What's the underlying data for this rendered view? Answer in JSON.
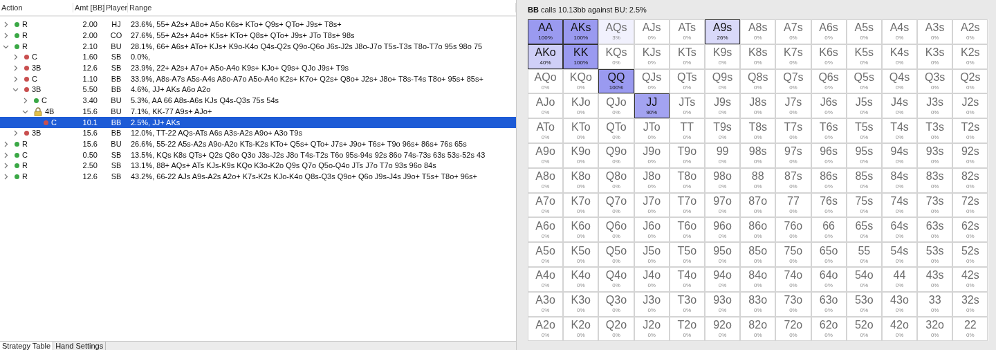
{
  "strategy_table": {
    "columns": [
      "Action",
      "Amt [BB]",
      "Player",
      "Range"
    ],
    "rows": [
      {
        "action": "R",
        "amount": "2.00",
        "player": "HJ",
        "range": "23.6%, 55+ A2s+ A8o+ A5o K6s+ KTo+ Q9s+ QTo+ J9s+ T8s+",
        "kind": "dot",
        "color": "#3aa845",
        "expanded": false,
        "selected": false
      },
      {
        "action": "R",
        "amount": "2.00",
        "player": "CO",
        "range": "27.6%, 55+ A2s+ A4o+ K5s+ KTo+ Q8s+ QTo+ J9s+ JTo T8s+ 98s",
        "kind": "dot",
        "color": "#3aa845",
        "expanded": false,
        "selected": false
      },
      {
        "action": "R",
        "amount": "2.10",
        "player": "BU",
        "range": "28.1%, 66+ A6s+ ATo+ KJs+ K9o-K4o Q4s-Q2s Q9o-Q6o J6s-J2s J8o-J7o T5s-T3s T8o-T7o 95s 98o 75",
        "kind": "dot",
        "color": "#3aa845",
        "expanded": true,
        "selected": false,
        "children": [
          {
            "action": "C",
            "amount": "1.60",
            "player": "SB",
            "range": "0.0%,",
            "kind": "dot",
            "color": "#c94f4f",
            "expanded": false,
            "selected": false
          },
          {
            "action": "3B",
            "amount": "12.6",
            "player": "SB",
            "range": "23.9%, 22+ A2s+ A7o+ A5o-A4o K9s+ KJo+ Q9s+ QJo J9s+ T9s",
            "kind": "dot",
            "color": "#c94f4f",
            "expanded": false,
            "selected": false
          },
          {
            "action": "C",
            "amount": "1.10",
            "player": "BB",
            "range": "33.9%, A8s-A7s A5s-A4s A8o-A7o A5o-A4o K2s+ K7o+ Q2s+ Q8o+ J2s+ J8o+ T8s-T4s T8o+ 95s+ 85s+",
            "kind": "dot",
            "color": "#c94f4f",
            "expanded": false,
            "selected": false
          },
          {
            "action": "3B",
            "amount": "5.50",
            "player": "BB",
            "range": "4.6%, JJ+ AKs A6o A2o",
            "kind": "dot",
            "color": "#c94f4f",
            "expanded": true,
            "selected": false,
            "children": [
              {
                "action": "C",
                "amount": "3.40",
                "player": "BU",
                "range": "5.3%, AA 66 A8s-A6s KJs Q4s-Q3s 75s 54s",
                "kind": "dot",
                "color": "#3aa845",
                "expanded": false,
                "selected": false
              },
              {
                "action": "4B",
                "amount": "15.6",
                "player": "BU",
                "range": "7.1%, KK-77 A9s+ AJo+",
                "kind": "lock",
                "expanded": true,
                "selected": false,
                "children": [
                  {
                    "action": "C",
                    "amount": "10.1",
                    "player": "BB",
                    "range": "2.5%, JJ+ AKs",
                    "kind": "dot",
                    "color": "#c94f4f",
                    "selected": true
                  }
                ]
              }
            ]
          },
          {
            "action": "3B",
            "amount": "15.6",
            "player": "BB",
            "range": "12.0%, TT-22 AQs-ATs A6s A3s-A2s A9o+ A3o T9s",
            "kind": "dot",
            "color": "#c94f4f",
            "expanded": false,
            "selected": false
          }
        ]
      },
      {
        "action": "R",
        "amount": "15.6",
        "player": "BU",
        "range": "26.6%, 55-22 A5s-A2s A9o-A2o KTs-K2s KTo+ Q5s+ QTo+ J7s+ J9o+ T6s+ T9o 96s+ 86s+ 76s 65s",
        "kind": "dot",
        "color": "#3aa845",
        "expanded": false,
        "selected": false
      },
      {
        "action": "C",
        "amount": "0.50",
        "player": "SB",
        "range": "13.5%, KQs K8s QTs+ Q2s Q8o Q3o J3s-J2s J8o T4s-T2s T6o 95s-94s 92s 86o 74s-73s 63s 53s-52s 43",
        "kind": "dot",
        "color": "#3aa845",
        "expanded": false,
        "selected": false
      },
      {
        "action": "R",
        "amount": "2.50",
        "player": "SB",
        "range": "13.1%, 88+ AQs+ ATs KJs-K9s KQo K3o-K2o Q9s Q7o Q5o-Q4o JTs J7o T7o 93s 96o 84s",
        "kind": "dot",
        "color": "#3aa845",
        "expanded": false,
        "selected": false
      },
      {
        "action": "R",
        "amount": "12.6",
        "player": "SB",
        "range": "43.2%, 66-22 AJs A9s-A2s A2o+ K7s-K2s KJo-K4o Q8s-Q3s Q9o+ Q6o J9s-J4s J9o+ T5s+ T8o+ 96s+",
        "kind": "dot",
        "color": "#3aa845",
        "expanded": false,
        "selected": false
      }
    ]
  },
  "tabs": [
    {
      "label": "Strategy Table",
      "selected": true
    },
    {
      "label": "Hand Settings",
      "selected": false
    }
  ],
  "range_panel": {
    "title": "**BB** calls 10.13bb against BU: 2.5%",
    "grid": {
      "rows": [
        {
          "cells": [
            {
              "hand": "AA",
              "pct": "100%",
              "color": "#9a9af0",
              "outlined": true
            },
            {
              "hand": "AKs",
              "pct": "100%",
              "color": "#9a9af0",
              "outlined": true
            },
            {
              "hand": "AQs",
              "pct": "3%",
              "color": "#f1f1fd",
              "outlined": false
            },
            {
              "hand": "AJs",
              "pct": "0%",
              "color": "#ffffff",
              "outlined": false
            },
            {
              "hand": "ATs",
              "pct": "0%",
              "color": "#ffffff",
              "outlined": false
            },
            {
              "hand": "A9s",
              "pct": "26%",
              "color": "#d9d9f9",
              "outlined": true
            },
            {
              "hand": "A8s",
              "pct": "0%",
              "color": "#ffffff",
              "outlined": false
            },
            {
              "hand": "A7s",
              "pct": "0%",
              "color": "#ffffff",
              "outlined": false
            },
            {
              "hand": "A6s",
              "pct": "0%",
              "color": "#ffffff",
              "outlined": false
            },
            {
              "hand": "A5s",
              "pct": "0%",
              "color": "#ffffff",
              "outlined": false
            },
            {
              "hand": "A4s",
              "pct": "0%",
              "color": "#ffffff",
              "outlined": false
            },
            {
              "hand": "A3s",
              "pct": "0%",
              "color": "#ffffff",
              "outlined": false
            },
            {
              "hand": "A2s",
              "pct": "0%",
              "color": "#ffffff",
              "outlined": false
            }
          ]
        },
        {
          "cells": [
            {
              "hand": "AKo",
              "pct": "40%",
              "color": "#cfcff7",
              "outlined": true
            },
            {
              "hand": "KK",
              "pct": "100%",
              "color": "#9a9af0",
              "outlined": true
            },
            {
              "hand": "KQs",
              "pct": "0%",
              "color": "#ffffff",
              "outlined": false
            },
            {
              "hand": "KJs",
              "pct": "0%",
              "color": "#ffffff",
              "outlined": false
            },
            {
              "hand": "KTs",
              "pct": "0%",
              "color": "#ffffff",
              "outlined": false
            },
            {
              "hand": "K9s",
              "pct": "0%",
              "color": "#ffffff",
              "outlined": false
            },
            {
              "hand": "K8s",
              "pct": "0%",
              "color": "#ffffff",
              "outlined": false
            },
            {
              "hand": "K7s",
              "pct": "0%",
              "color": "#ffffff",
              "outlined": false
            },
            {
              "hand": "K6s",
              "pct": "0%",
              "color": "#ffffff",
              "outlined": false
            },
            {
              "hand": "K5s",
              "pct": "0%",
              "color": "#ffffff",
              "outlined": false
            },
            {
              "hand": "K4s",
              "pct": "0%",
              "color": "#ffffff",
              "outlined": false
            },
            {
              "hand": "K3s",
              "pct": "0%",
              "color": "#ffffff",
              "outlined": false
            },
            {
              "hand": "K2s",
              "pct": "0%",
              "color": "#ffffff",
              "outlined": false
            }
          ]
        },
        {
          "cells": [
            {
              "hand": "AQo",
              "pct": "0%",
              "color": "#ffffff",
              "outlined": false
            },
            {
              "hand": "KQo",
              "pct": "0%",
              "color": "#ffffff",
              "outlined": false
            },
            {
              "hand": "QQ",
              "pct": "100%",
              "color": "#9a9af0",
              "outlined": true
            },
            {
              "hand": "QJs",
              "pct": "0%",
              "color": "#ffffff",
              "outlined": false
            },
            {
              "hand": "QTs",
              "pct": "0%",
              "color": "#ffffff",
              "outlined": false
            },
            {
              "hand": "Q9s",
              "pct": "0%",
              "color": "#ffffff",
              "outlined": false
            },
            {
              "hand": "Q8s",
              "pct": "0%",
              "color": "#ffffff",
              "outlined": false
            },
            {
              "hand": "Q7s",
              "pct": "0%",
              "color": "#ffffff",
              "outlined": false
            },
            {
              "hand": "Q6s",
              "pct": "0%",
              "color": "#ffffff",
              "outlined": false
            },
            {
              "hand": "Q5s",
              "pct": "0%",
              "color": "#ffffff",
              "outlined": false
            },
            {
              "hand": "Q4s",
              "pct": "0%",
              "color": "#ffffff",
              "outlined": false
            },
            {
              "hand": "Q3s",
              "pct": "0%",
              "color": "#ffffff",
              "outlined": false
            },
            {
              "hand": "Q2s",
              "pct": "0%",
              "color": "#ffffff",
              "outlined": false
            }
          ]
        },
        {
          "cells": [
            {
              "hand": "AJo",
              "pct": "0%",
              "color": "#ffffff",
              "outlined": false
            },
            {
              "hand": "KJo",
              "pct": "0%",
              "color": "#ffffff",
              "outlined": false
            },
            {
              "hand": "QJo",
              "pct": "0%",
              "color": "#ffffff",
              "outlined": false
            },
            {
              "hand": "JJ",
              "pct": "90%",
              "color": "#a3a3f1",
              "outlined": true
            },
            {
              "hand": "JTs",
              "pct": "0%",
              "color": "#ffffff",
              "outlined": false
            },
            {
              "hand": "J9s",
              "pct": "0%",
              "color": "#ffffff",
              "outlined": false
            },
            {
              "hand": "J8s",
              "pct": "0%",
              "color": "#ffffff",
              "outlined": false
            },
            {
              "hand": "J7s",
              "pct": "0%",
              "color": "#ffffff",
              "outlined": false
            },
            {
              "hand": "J6s",
              "pct": "0%",
              "color": "#ffffff",
              "outlined": false
            },
            {
              "hand": "J5s",
              "pct": "0%",
              "color": "#ffffff",
              "outlined": false
            },
            {
              "hand": "J4s",
              "pct": "0%",
              "color": "#ffffff",
              "outlined": false
            },
            {
              "hand": "J3s",
              "pct": "0%",
              "color": "#ffffff",
              "outlined": false
            },
            {
              "hand": "J2s",
              "pct": "0%",
              "color": "#ffffff",
              "outlined": false
            }
          ]
        },
        {
          "cells": [
            {
              "hand": "ATo",
              "pct": "0%",
              "color": "#ffffff",
              "outlined": false
            },
            {
              "hand": "KTo",
              "pct": "0%",
              "color": "#ffffff",
              "outlined": false
            },
            {
              "hand": "QTo",
              "pct": "0%",
              "color": "#ffffff",
              "outlined": false
            },
            {
              "hand": "JTo",
              "pct": "0%",
              "color": "#ffffff",
              "outlined": false
            },
            {
              "hand": "TT",
              "pct": "0%",
              "color": "#ffffff",
              "outlined": false
            },
            {
              "hand": "T9s",
              "pct": "0%",
              "color": "#ffffff",
              "outlined": false
            },
            {
              "hand": "T8s",
              "pct": "0%",
              "color": "#ffffff",
              "outlined": false
            },
            {
              "hand": "T7s",
              "pct": "0%",
              "color": "#ffffff",
              "outlined": false
            },
            {
              "hand": "T6s",
              "pct": "0%",
              "color": "#ffffff",
              "outlined": false
            },
            {
              "hand": "T5s",
              "pct": "0%",
              "color": "#ffffff",
              "outlined": false
            },
            {
              "hand": "T4s",
              "pct": "0%",
              "color": "#ffffff",
              "outlined": false
            },
            {
              "hand": "T3s",
              "pct": "0%",
              "color": "#ffffff",
              "outlined": false
            },
            {
              "hand": "T2s",
              "pct": "0%",
              "color": "#ffffff",
              "outlined": false
            }
          ]
        },
        {
          "cells": [
            {
              "hand": "A9o",
              "pct": "0%",
              "color": "#ffffff",
              "outlined": false
            },
            {
              "hand": "K9o",
              "pct": "0%",
              "color": "#ffffff",
              "outlined": false
            },
            {
              "hand": "Q9o",
              "pct": "0%",
              "color": "#ffffff",
              "outlined": false
            },
            {
              "hand": "J9o",
              "pct": "0%",
              "color": "#ffffff",
              "outlined": false
            },
            {
              "hand": "T9o",
              "pct": "0%",
              "color": "#ffffff",
              "outlined": false
            },
            {
              "hand": "99",
              "pct": "0%",
              "color": "#ffffff",
              "outlined": false
            },
            {
              "hand": "98s",
              "pct": "0%",
              "color": "#ffffff",
              "outlined": false
            },
            {
              "hand": "97s",
              "pct": "0%",
              "color": "#ffffff",
              "outlined": false
            },
            {
              "hand": "96s",
              "pct": "0%",
              "color": "#ffffff",
              "outlined": false
            },
            {
              "hand": "95s",
              "pct": "0%",
              "color": "#ffffff",
              "outlined": false
            },
            {
              "hand": "94s",
              "pct": "0%",
              "color": "#ffffff",
              "outlined": false
            },
            {
              "hand": "93s",
              "pct": "0%",
              "color": "#ffffff",
              "outlined": false
            },
            {
              "hand": "92s",
              "pct": "0%",
              "color": "#ffffff",
              "outlined": false
            }
          ]
        },
        {
          "cells": [
            {
              "hand": "A8o",
              "pct": "0%",
              "color": "#ffffff",
              "outlined": false
            },
            {
              "hand": "K8o",
              "pct": "0%",
              "color": "#ffffff",
              "outlined": false
            },
            {
              "hand": "Q8o",
              "pct": "0%",
              "color": "#ffffff",
              "outlined": false
            },
            {
              "hand": "J8o",
              "pct": "0%",
              "color": "#ffffff",
              "outlined": false
            },
            {
              "hand": "T8o",
              "pct": "0%",
              "color": "#ffffff",
              "outlined": false
            },
            {
              "hand": "98o",
              "pct": "0%",
              "color": "#ffffff",
              "outlined": false
            },
            {
              "hand": "88",
              "pct": "0%",
              "color": "#ffffff",
              "outlined": false
            },
            {
              "hand": "87s",
              "pct": "0%",
              "color": "#ffffff",
              "outlined": false
            },
            {
              "hand": "86s",
              "pct": "0%",
              "color": "#ffffff",
              "outlined": false
            },
            {
              "hand": "85s",
              "pct": "0%",
              "color": "#ffffff",
              "outlined": false
            },
            {
              "hand": "84s",
              "pct": "0%",
              "color": "#ffffff",
              "outlined": false
            },
            {
              "hand": "83s",
              "pct": "0%",
              "color": "#ffffff",
              "outlined": false
            },
            {
              "hand": "82s",
              "pct": "0%",
              "color": "#ffffff",
              "outlined": false
            }
          ]
        },
        {
          "cells": [
            {
              "hand": "A7o",
              "pct": "0%",
              "color": "#ffffff",
              "outlined": false
            },
            {
              "hand": "K7o",
              "pct": "0%",
              "color": "#ffffff",
              "outlined": false
            },
            {
              "hand": "Q7o",
              "pct": "0%",
              "color": "#ffffff",
              "outlined": false
            },
            {
              "hand": "J7o",
              "pct": "0%",
              "color": "#ffffff",
              "outlined": false
            },
            {
              "hand": "T7o",
              "pct": "0%",
              "color": "#ffffff",
              "outlined": false
            },
            {
              "hand": "97o",
              "pct": "0%",
              "color": "#ffffff",
              "outlined": false
            },
            {
              "hand": "87o",
              "pct": "0%",
              "color": "#ffffff",
              "outlined": false
            },
            {
              "hand": "77",
              "pct": "0%",
              "color": "#ffffff",
              "outlined": false
            },
            {
              "hand": "76s",
              "pct": "0%",
              "color": "#ffffff",
              "outlined": false
            },
            {
              "hand": "75s",
              "pct": "0%",
              "color": "#ffffff",
              "outlined": false
            },
            {
              "hand": "74s",
              "pct": "0%",
              "color": "#ffffff",
              "outlined": false
            },
            {
              "hand": "73s",
              "pct": "0%",
              "color": "#ffffff",
              "outlined": false
            },
            {
              "hand": "72s",
              "pct": "0%",
              "color": "#ffffff",
              "outlined": false
            }
          ]
        },
        {
          "cells": [
            {
              "hand": "A6o",
              "pct": "0%",
              "color": "#ffffff",
              "outlined": false
            },
            {
              "hand": "K6o",
              "pct": "0%",
              "color": "#ffffff",
              "outlined": false
            },
            {
              "hand": "Q6o",
              "pct": "0%",
              "color": "#ffffff",
              "outlined": false
            },
            {
              "hand": "J6o",
              "pct": "0%",
              "color": "#ffffff",
              "outlined": false
            },
            {
              "hand": "T6o",
              "pct": "0%",
              "color": "#ffffff",
              "outlined": false
            },
            {
              "hand": "96o",
              "pct": "0%",
              "color": "#ffffff",
              "outlined": false
            },
            {
              "hand": "86o",
              "pct": "0%",
              "color": "#ffffff",
              "outlined": false
            },
            {
              "hand": "76o",
              "pct": "0%",
              "color": "#ffffff",
              "outlined": false
            },
            {
              "hand": "66",
              "pct": "0%",
              "color": "#ffffff",
              "outlined": false
            },
            {
              "hand": "65s",
              "pct": "0%",
              "color": "#ffffff",
              "outlined": false
            },
            {
              "hand": "64s",
              "pct": "0%",
              "color": "#ffffff",
              "outlined": false
            },
            {
              "hand": "63s",
              "pct": "0%",
              "color": "#ffffff",
              "outlined": false
            },
            {
              "hand": "62s",
              "pct": "0%",
              "color": "#ffffff",
              "outlined": false
            }
          ]
        },
        {
          "cells": [
            {
              "hand": "A5o",
              "pct": "0%",
              "color": "#ffffff",
              "outlined": false
            },
            {
              "hand": "K5o",
              "pct": "0%",
              "color": "#ffffff",
              "outlined": false
            },
            {
              "hand": "Q5o",
              "pct": "0%",
              "color": "#ffffff",
              "outlined": false
            },
            {
              "hand": "J5o",
              "pct": "0%",
              "color": "#ffffff",
              "outlined": false
            },
            {
              "hand": "T5o",
              "pct": "0%",
              "color": "#ffffff",
              "outlined": false
            },
            {
              "hand": "95o",
              "pct": "0%",
              "color": "#ffffff",
              "outlined": false
            },
            {
              "hand": "85o",
              "pct": "0%",
              "color": "#ffffff",
              "outlined": false
            },
            {
              "hand": "75o",
              "pct": "0%",
              "color": "#ffffff",
              "outlined": false
            },
            {
              "hand": "65o",
              "pct": "0%",
              "color": "#ffffff",
              "outlined": false
            },
            {
              "hand": "55",
              "pct": "0%",
              "color": "#ffffff",
              "outlined": false
            },
            {
              "hand": "54s",
              "pct": "0%",
              "color": "#ffffff",
              "outlined": false
            },
            {
              "hand": "53s",
              "pct": "0%",
              "color": "#ffffff",
              "outlined": false
            },
            {
              "hand": "52s",
              "pct": "0%",
              "color": "#ffffff",
              "outlined": false
            }
          ]
        },
        {
          "cells": [
            {
              "hand": "A4o",
              "pct": "0%",
              "color": "#ffffff",
              "outlined": false
            },
            {
              "hand": "K4o",
              "pct": "0%",
              "color": "#ffffff",
              "outlined": false
            },
            {
              "hand": "Q4o",
              "pct": "0%",
              "color": "#ffffff",
              "outlined": false
            },
            {
              "hand": "J4o",
              "pct": "0%",
              "color": "#ffffff",
              "outlined": false
            },
            {
              "hand": "T4o",
              "pct": "0%",
              "color": "#ffffff",
              "outlined": false
            },
            {
              "hand": "94o",
              "pct": "0%",
              "color": "#ffffff",
              "outlined": false
            },
            {
              "hand": "84o",
              "pct": "0%",
              "color": "#ffffff",
              "outlined": false
            },
            {
              "hand": "74o",
              "pct": "0%",
              "color": "#ffffff",
              "outlined": false
            },
            {
              "hand": "64o",
              "pct": "0%",
              "color": "#ffffff",
              "outlined": false
            },
            {
              "hand": "54o",
              "pct": "0%",
              "color": "#ffffff",
              "outlined": false
            },
            {
              "hand": "44",
              "pct": "0%",
              "color": "#ffffff",
              "outlined": false
            },
            {
              "hand": "43s",
              "pct": "0%",
              "color": "#ffffff",
              "outlined": false
            },
            {
              "hand": "42s",
              "pct": "0%",
              "color": "#ffffff",
              "outlined": false
            }
          ]
        },
        {
          "cells": [
            {
              "hand": "A3o",
              "pct": "0%",
              "color": "#ffffff",
              "outlined": false
            },
            {
              "hand": "K3o",
              "pct": "0%",
              "color": "#ffffff",
              "outlined": false
            },
            {
              "hand": "Q3o",
              "pct": "0%",
              "color": "#ffffff",
              "outlined": false
            },
            {
              "hand": "J3o",
              "pct": "0%",
              "color": "#ffffff",
              "outlined": false
            },
            {
              "hand": "T3o",
              "pct": "0%",
              "color": "#ffffff",
              "outlined": false
            },
            {
              "hand": "93o",
              "pct": "0%",
              "color": "#ffffff",
              "outlined": false
            },
            {
              "hand": "83o",
              "pct": "0%",
              "color": "#ffffff",
              "outlined": false
            },
            {
              "hand": "73o",
              "pct": "0%",
              "color": "#ffffff",
              "outlined": false
            },
            {
              "hand": "63o",
              "pct": "0%",
              "color": "#ffffff",
              "outlined": false
            },
            {
              "hand": "53o",
              "pct": "0%",
              "color": "#ffffff",
              "outlined": false
            },
            {
              "hand": "43o",
              "pct": "0%",
              "color": "#ffffff",
              "outlined": false
            },
            {
              "hand": "33",
              "pct": "0%",
              "color": "#ffffff",
              "outlined": false
            },
            {
              "hand": "32s",
              "pct": "0%",
              "color": "#ffffff",
              "outlined": false
            }
          ]
        },
        {
          "cells": [
            {
              "hand": "A2o",
              "pct": "0%",
              "color": "#ffffff",
              "outlined": false
            },
            {
              "hand": "K2o",
              "pct": "0%",
              "color": "#ffffff",
              "outlined": false
            },
            {
              "hand": "Q2o",
              "pct": "0%",
              "color": "#ffffff",
              "outlined": false
            },
            {
              "hand": "J2o",
              "pct": "0%",
              "color": "#ffffff",
              "outlined": false
            },
            {
              "hand": "T2o",
              "pct": "0%",
              "color": "#ffffff",
              "outlined": false
            },
            {
              "hand": "92o",
              "pct": "0%",
              "color": "#ffffff",
              "outlined": false
            },
            {
              "hand": "82o",
              "pct": "0%",
              "color": "#ffffff",
              "outlined": false
            },
            {
              "hand": "72o",
              "pct": "0%",
              "color": "#ffffff",
              "outlined": false
            },
            {
              "hand": "62o",
              "pct": "0%",
              "color": "#ffffff",
              "outlined": false
            },
            {
              "hand": "52o",
              "pct": "0%",
              "color": "#ffffff",
              "outlined": false
            },
            {
              "hand": "42o",
              "pct": "0%",
              "color": "#ffffff",
              "outlined": false
            },
            {
              "hand": "32o",
              "pct": "0%",
              "color": "#ffffff",
              "outlined": false
            },
            {
              "hand": "22",
              "pct": "0%",
              "color": "#ffffff",
              "outlined": false
            }
          ]
        }
      ]
    }
  }
}
